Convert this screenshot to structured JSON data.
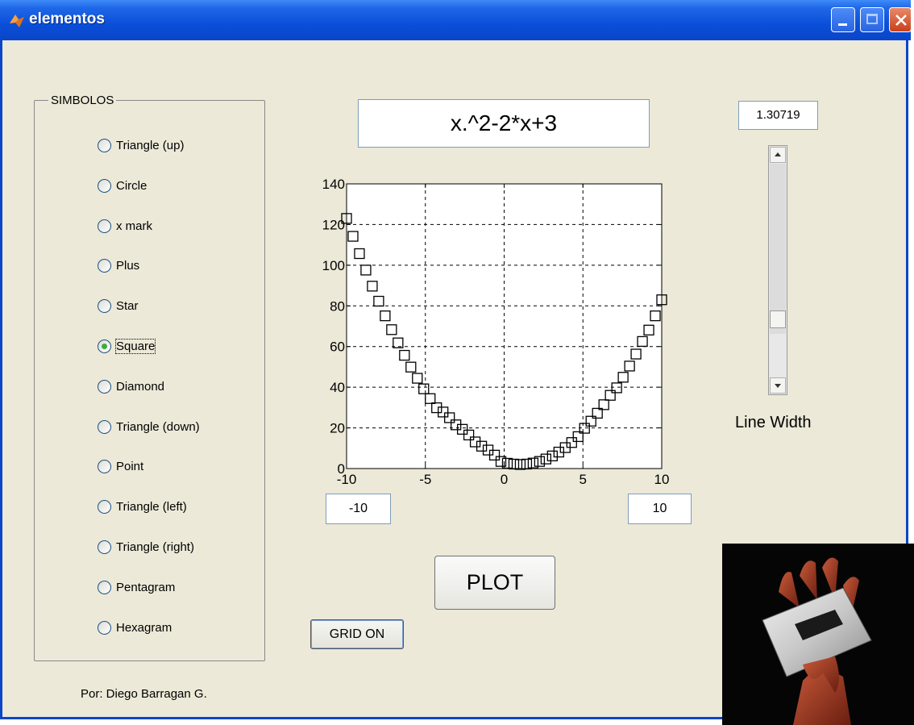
{
  "window": {
    "title": "elementos",
    "icon": "matlab-icon"
  },
  "panel": {
    "title": "SIMBOLOS",
    "options": [
      {
        "label": "Triangle (up)",
        "selected": false
      },
      {
        "label": "Circle",
        "selected": false
      },
      {
        "label": "x mark",
        "selected": false
      },
      {
        "label": "Plus",
        "selected": false
      },
      {
        "label": "Star",
        "selected": false
      },
      {
        "label": "Square",
        "selected": true
      },
      {
        "label": "Diamond",
        "selected": false
      },
      {
        "label": "Triangle (down)",
        "selected": false
      },
      {
        "label": "Point",
        "selected": false
      },
      {
        "label": "Triangle (left)",
        "selected": false
      },
      {
        "label": "Triangle (right)",
        "selected": false
      },
      {
        "label": "Pentagram",
        "selected": false
      },
      {
        "label": "Hexagram",
        "selected": false
      }
    ]
  },
  "author": "Por: Diego Barragan G.",
  "function_field": {
    "value": "x.^2-2*x+3"
  },
  "x_min_field": {
    "value": "-10"
  },
  "x_max_field": {
    "value": "10"
  },
  "line_width": {
    "value": "1.30719",
    "label": "Line Width",
    "slider_fraction": 0.25
  },
  "buttons": {
    "plot": "PLOT",
    "grid": "GRID ON"
  },
  "chart_data": {
    "type": "scatter",
    "marker": "square",
    "function": "x.^2-2*x+3",
    "xlim": [
      -10,
      10
    ],
    "ylim": [
      0,
      140
    ],
    "x_ticks": [
      "-10",
      "-5",
      "0",
      "5",
      "10"
    ],
    "y_ticks": [
      "0",
      "20",
      "40",
      "60",
      "80",
      "100",
      "120",
      "140"
    ],
    "grid": true,
    "x": [
      -10,
      -9.5918,
      -9.1837,
      -8.7755,
      -8.3673,
      -7.9592,
      -7.551,
      -7.1429,
      -6.7347,
      -6.3265,
      -5.9184,
      -5.5102,
      -5.102,
      -4.6939,
      -4.2857,
      -3.8776,
      -3.4694,
      -3.0612,
      -2.6531,
      -2.2449,
      -1.8367,
      -1.4286,
      -1.0204,
      -0.6122,
      -0.2041,
      0.2041,
      0.6122,
      1.0204,
      1.4286,
      1.8367,
      2.2449,
      2.6531,
      3.0612,
      3.4694,
      3.8776,
      4.2857,
      4.6939,
      5.102,
      5.5102,
      5.9184,
      6.3265,
      6.7347,
      7.1429,
      7.551,
      7.9592,
      8.3673,
      8.7755,
      9.1837,
      9.5918,
      10
    ],
    "y": [
      123,
      114.2,
      105.7,
      97.6,
      89.7,
      82.3,
      75.1,
      68.3,
      61.8,
      55.7,
      49.9,
      44.4,
      39.2,
      34.4,
      29.9,
      27.8,
      25.0,
      21.5,
      19.3,
      16.5,
      13.1,
      11.0,
      9.1,
      6.6,
      3.5,
      2.6,
      2.2,
      2.0,
      2.2,
      2.7,
      3.5,
      4.7,
      6.2,
      8.1,
      10.3,
      12.8,
      15.7,
      19.8,
      23.3,
      27.2,
      31.4,
      36.0,
      39.7,
      44.9,
      50.4,
      56.3,
      62.5,
      68.1,
      75.1,
      83
    ]
  },
  "album_art": {
    "description": "album-cover-image"
  }
}
